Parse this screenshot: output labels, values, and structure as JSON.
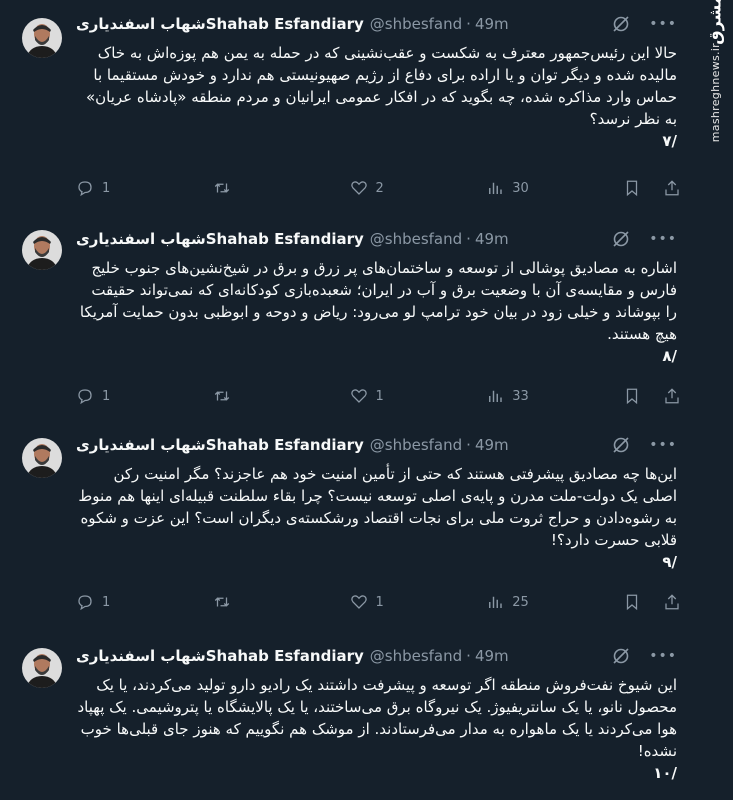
{
  "watermark": {
    "logo": "مشرق",
    "site": "mashreghnews.ir"
  },
  "tweets": [
    {
      "name_fa": "شهاب اسفندیاری",
      "name_en": "Shahab Esfandiary",
      "handle": "@shbesfand",
      "sep": "·",
      "time": "49m",
      "text": "حالا این رئیس‌جمهور معترف به شکست و عقب‌نشینی که در حمله به یمن هم پوزه‌اش به خاک مالیده شده و دیگر توان و یا اراده برای دفاع از رژیم صهیونیستی هم ندارد و خودش مستقیما با حماس وارد مذاکره شده، چه بگوید که در افکار عمومی ایرانیان و مردم منطقه «پادشاه عریان» به نظر نرسد؟",
      "number": "/۷",
      "replies": "1",
      "reposts": "",
      "likes": "2",
      "views": "30"
    },
    {
      "name_fa": "شهاب اسفندیاری",
      "name_en": "Shahab Esfandiary",
      "handle": "@shbesfand",
      "sep": "·",
      "time": "49m",
      "text": "اشاره به مصادیق پوشالی از توسعه و ساختمان‌های پر زرق و برق در شیخ‌نشین‌های جنوب خلیج فارس و مقایسه‌ی آن با وضعیت برق و آب در ایران؛ شعبده‌بازی کودکانه‌ای که نمی‌تواند حقیقت را بپوشاند و خیلی زود در بیان خود ترامپ لو می‌رود: ریاض و دوحه و ابوظبی بدون حمایت آمریکا هیچ هستند.",
      "number": "/۸",
      "replies": "1",
      "reposts": "",
      "likes": "1",
      "views": "33"
    },
    {
      "name_fa": "شهاب اسفندیاری",
      "name_en": "Shahab Esfandiary",
      "handle": "@shbesfand",
      "sep": "·",
      "time": "49m",
      "text": "این‌ها چه مصادیق پیشرفتی هستند که حتی از تأمین امنیت خود هم عاجزند؟ مگر امنیت رکن اصلی یک دولت-ملت مدرن و پایه‌ی اصلی توسعه نیست؟ چرا بقاء سلطنت قبیله‌ای اینها هم منوط به رشوه‌دادن و حراج ثروت ملی برای نجات اقتصاد ورشکسته‌ی دیگران است؟ این عزت و شکوه قلابی حسرت دارد؟!",
      "number": "/۹",
      "replies": "1",
      "reposts": "",
      "likes": "1",
      "views": "25"
    },
    {
      "name_fa": "شهاب اسفندیاری",
      "name_en": "Shahab Esfandiary",
      "handle": "@shbesfand",
      "sep": "·",
      "time": "49m",
      "text": "این شیوخ نفت‌فروش منطقه اگر توسعه و پیشرفت داشتند یک رادیو دارو تولید می‌کردند، یا یک محصول نانو، یا یک سانتریفیوژ. یک نیروگاه برق می‌ساختند، یا یک پالایشگاه یا پتروشیمی. یک پهپاد هوا می‌کردند یا یک ماهواره به مدار می‌فرستادند. از موشک هم نگوییم که هنوز جای قبلی‌ها خوب نشده!",
      "number": "/۱۰"
    }
  ],
  "colors": {
    "background": "#15202b",
    "text": "#f7f9f9",
    "muted": "#8b98a5"
  }
}
